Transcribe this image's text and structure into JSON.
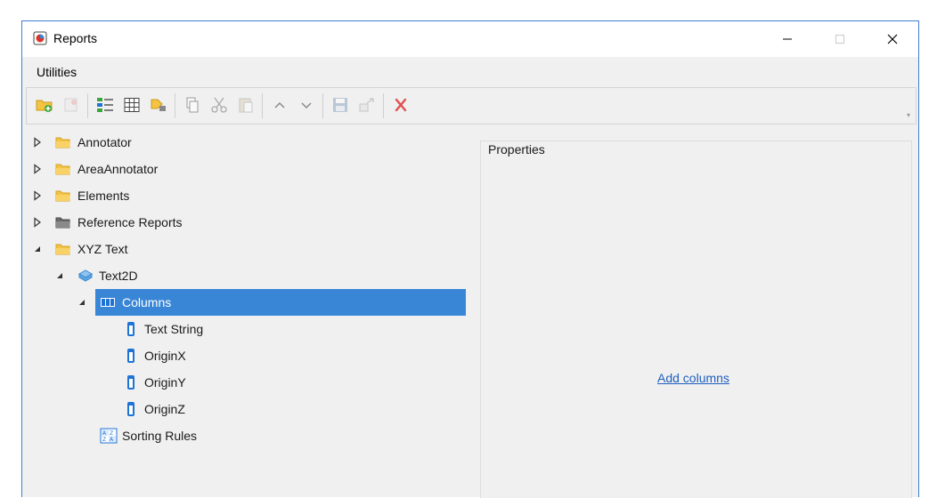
{
  "window": {
    "title": "Reports"
  },
  "menu": {
    "items": [
      "Utilities"
    ]
  },
  "toolbar": {
    "buttons": [
      "add-folder-icon",
      "add-report-icon",
      "list-view-icon",
      "table-icon",
      "tag-icon",
      "copy-icon",
      "cut-icon",
      "paste-icon",
      "move-up-icon",
      "move-down-icon",
      "save-icon",
      "export-icon",
      "delete-icon"
    ],
    "overflow": "▾"
  },
  "tree": {
    "nodes": [
      {
        "label": "Annotator",
        "icon": "folder-icon",
        "expander": "collapsed"
      },
      {
        "label": "AreaAnnotator",
        "icon": "folder-icon",
        "expander": "collapsed"
      },
      {
        "label": "Elements",
        "icon": "folder-icon",
        "expander": "collapsed"
      },
      {
        "label": "Reference Reports",
        "icon": "dark-folder-icon",
        "expander": "collapsed"
      },
      {
        "label": "XYZ Text",
        "icon": "folder-icon",
        "expander": "expanded"
      },
      {
        "label": "Text2D",
        "icon": "report-icon",
        "expander": "expanded"
      },
      {
        "label": "Columns",
        "icon": "columns-icon",
        "expander": "expanded",
        "selected": true
      },
      {
        "label": "Text String",
        "icon": "column-icon"
      },
      {
        "label": "OriginX",
        "icon": "column-icon"
      },
      {
        "label": "OriginY",
        "icon": "column-icon"
      },
      {
        "label": "OriginZ",
        "icon": "column-icon"
      },
      {
        "label": "Sorting Rules",
        "icon": "sorting-icon"
      }
    ]
  },
  "properties": {
    "title": "Properties",
    "add_columns_link": "Add columns"
  },
  "colors": {
    "selection": "#3a86d6",
    "link": "#1f5fbf",
    "folder": "#f5c342",
    "column": "#1e73d6",
    "delete": "#e05050"
  }
}
